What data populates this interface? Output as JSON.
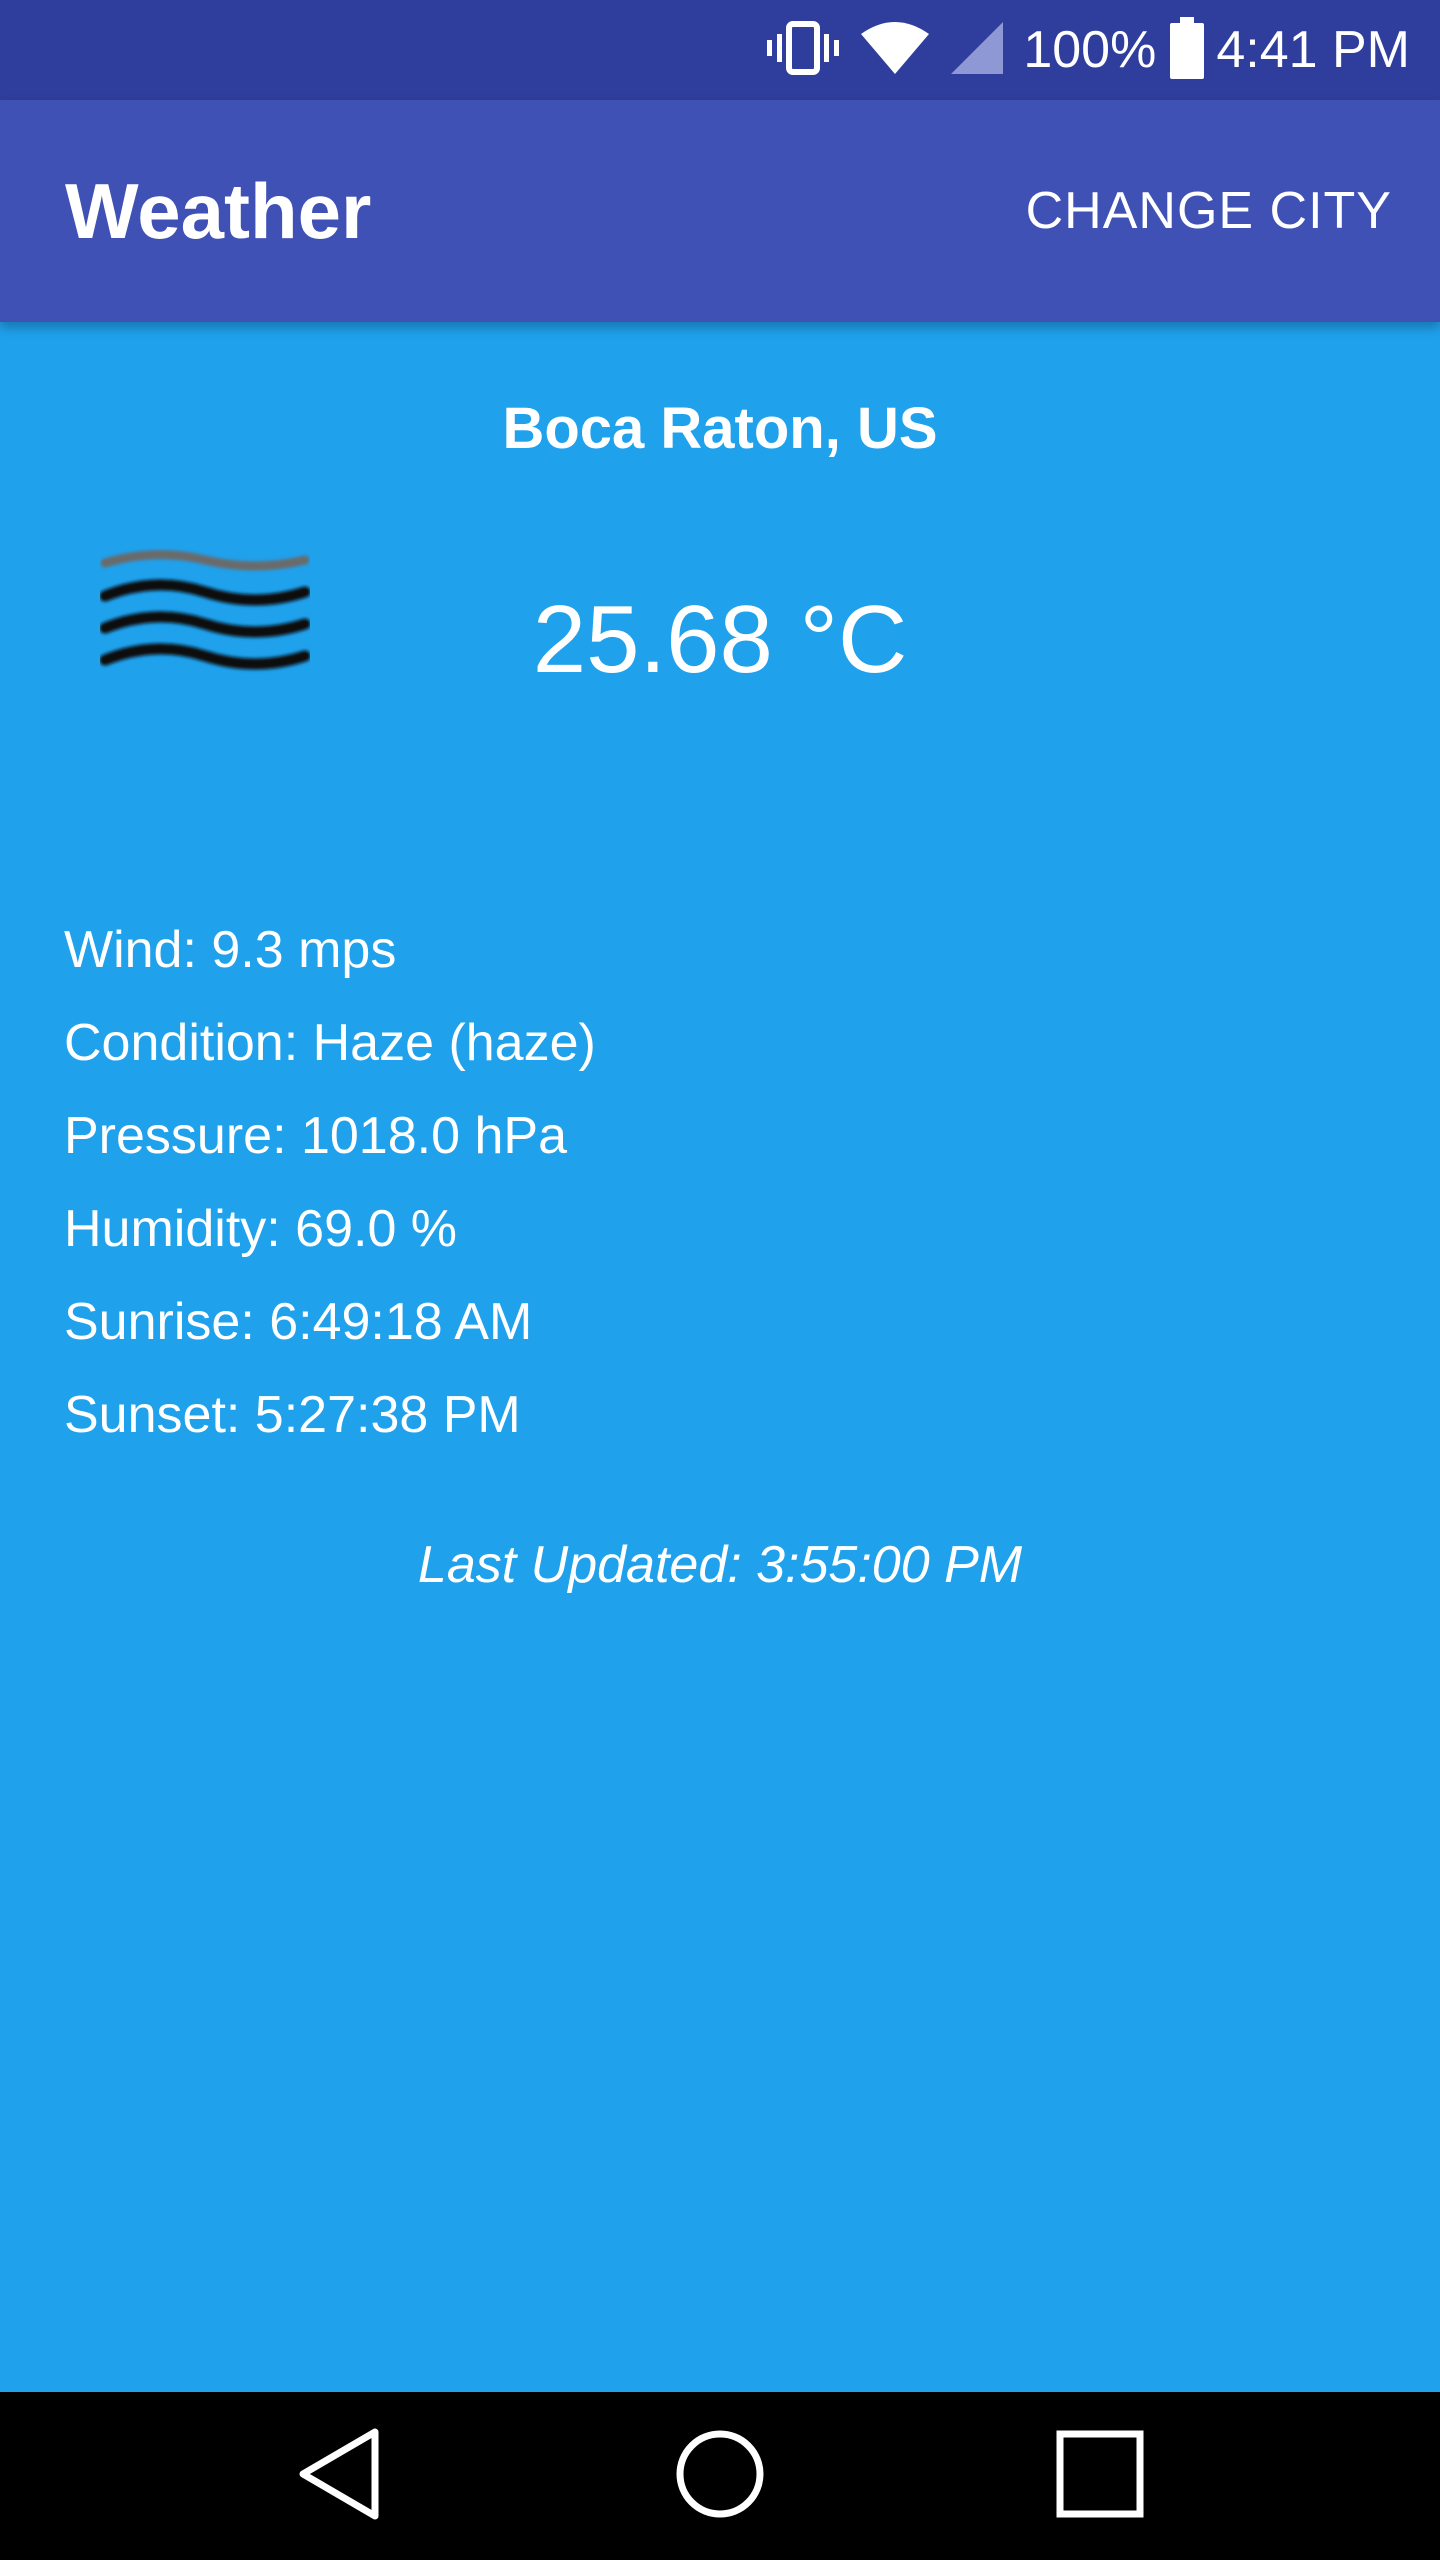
{
  "status_bar": {
    "battery_percent": "100%",
    "time": "4:41 PM",
    "icons": [
      "vibrate-icon",
      "wifi-icon",
      "cell-signal-icon",
      "battery-icon"
    ]
  },
  "app_bar": {
    "title": "Weather",
    "action_label": "CHANGE CITY"
  },
  "weather": {
    "city": "Boca Raton, US",
    "temperature": "25.68 °C",
    "condition_icon": "haze-icon",
    "details": [
      "Wind: 9.3 mps",
      "Condition: Haze (haze)",
      "Pressure: 1018.0 hPa",
      "Humidity: 69.0 %",
      "Sunrise: 6:49:18 AM",
      "Sunset: 5:27:38 PM"
    ],
    "last_updated": "Last Updated: 3:55:00 PM"
  },
  "nav_bar": {
    "buttons": [
      "back-icon",
      "home-icon",
      "recents-icon"
    ]
  },
  "colors": {
    "status_bar": "#2f3d9c",
    "app_bar": "#3f51b5",
    "background": "#1fa1ec",
    "nav_bar": "#000000",
    "text": "#ffffff"
  }
}
